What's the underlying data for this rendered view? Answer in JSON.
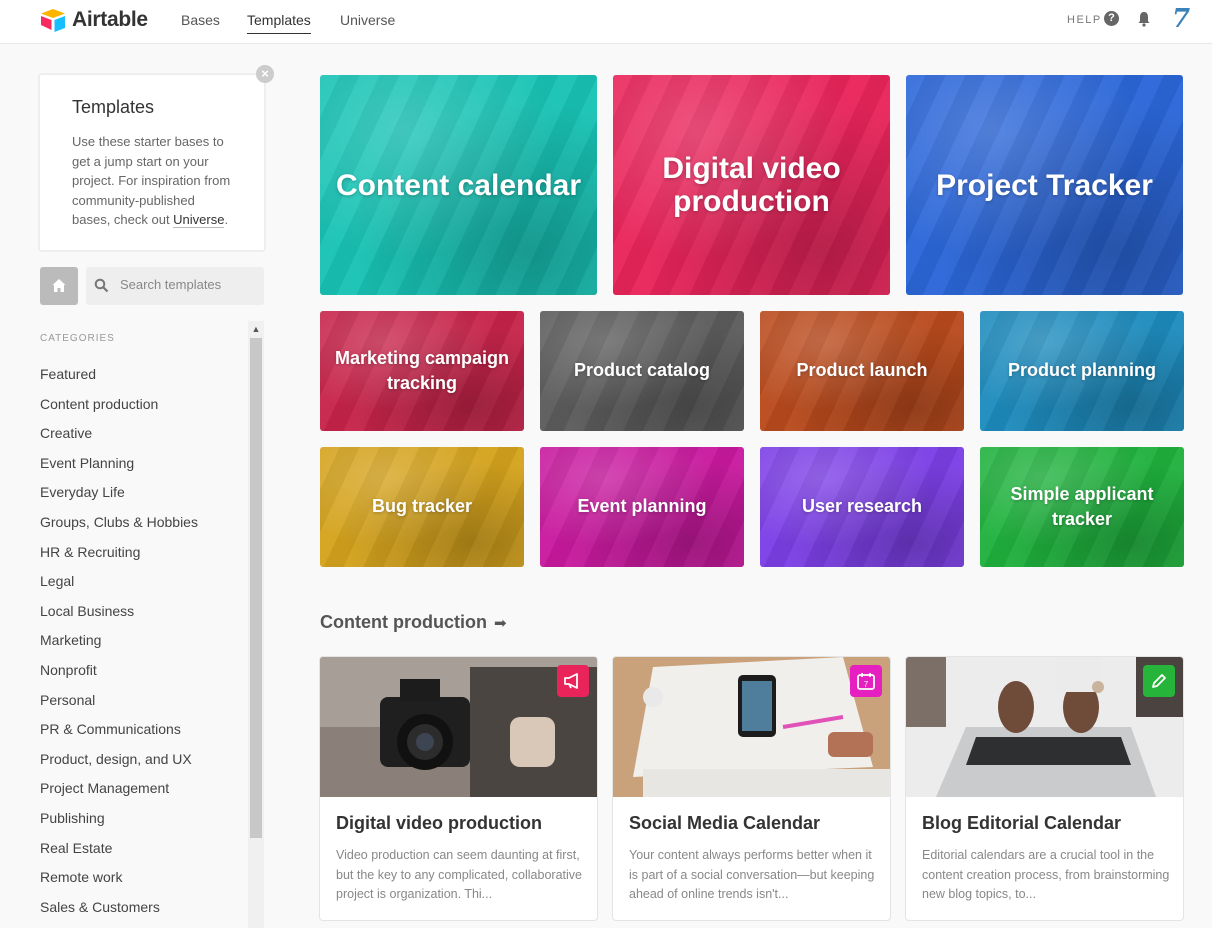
{
  "header": {
    "app_name": "Airtable",
    "nav": [
      "Bases",
      "Templates",
      "Universe"
    ],
    "active_nav": "Templates",
    "help_label": "HELP",
    "avatar_text": "7"
  },
  "intro": {
    "title": "Templates",
    "text_before": "Use these starter bases to get a jump start on your project. For inspiration from community-published bases, check out ",
    "link_text": "Universe",
    "text_after": ".",
    "close_icon": "×"
  },
  "search": {
    "placeholder": "Search templates"
  },
  "categories": {
    "heading": "CATEGORIES",
    "items": [
      "Featured",
      "Content production",
      "Creative",
      "Event Planning",
      "Everyday Life",
      "Groups, Clubs & Hobbies",
      "HR & Recruiting",
      "Legal",
      "Local Business",
      "Marketing",
      "Nonprofit",
      "Personal",
      "PR & Communications",
      "Product, design, and UX",
      "Project Management",
      "Publishing",
      "Real Estate",
      "Remote work",
      "Sales & Customers"
    ]
  },
  "featured": [
    {
      "title": "Content calendar",
      "color": "#18c3b5"
    },
    {
      "title": "Digital video production",
      "color": "#e9245b"
    },
    {
      "title": "Project Tracker",
      "color": "#2b66d8"
    },
    {
      "title": "Marketing campaign tracking",
      "color": "#c7244a"
    },
    {
      "title": "Product catalog",
      "color": "#5c5c5c"
    },
    {
      "title": "Product launch",
      "color": "#b94a1c"
    },
    {
      "title": "Product planning",
      "color": "#1d8bbd"
    },
    {
      "title": "Bug tracker",
      "color": "#d4a21c"
    },
    {
      "title": "Event planning",
      "color": "#c8199e"
    },
    {
      "title": "User research",
      "color": "#7c3fe6"
    },
    {
      "title": "Simple applicant tracker",
      "color": "#1fb13d"
    }
  ],
  "section": {
    "title": "Content production",
    "arrow": "➡"
  },
  "cards": [
    {
      "title": "Digital video production",
      "description": "Video production can seem daunting at first, but the key to any complicated, collaborative project is organization. Thi...",
      "badge_color": "#e9245b",
      "badge_icon": "megaphone-icon"
    },
    {
      "title": "Social Media Calendar",
      "description": "Your content always performs better when it is part of a social conversation—but keeping ahead of online trends isn't...",
      "badge_color": "#e61fc1",
      "badge_icon": "calendar-icon"
    },
    {
      "title": "Blog Editorial Calendar",
      "description": "Editorial calendars are a crucial tool in the content creation process, from brainstorming new blog topics, to...",
      "badge_color": "#26b53a",
      "badge_icon": "pencil-icon"
    }
  ]
}
